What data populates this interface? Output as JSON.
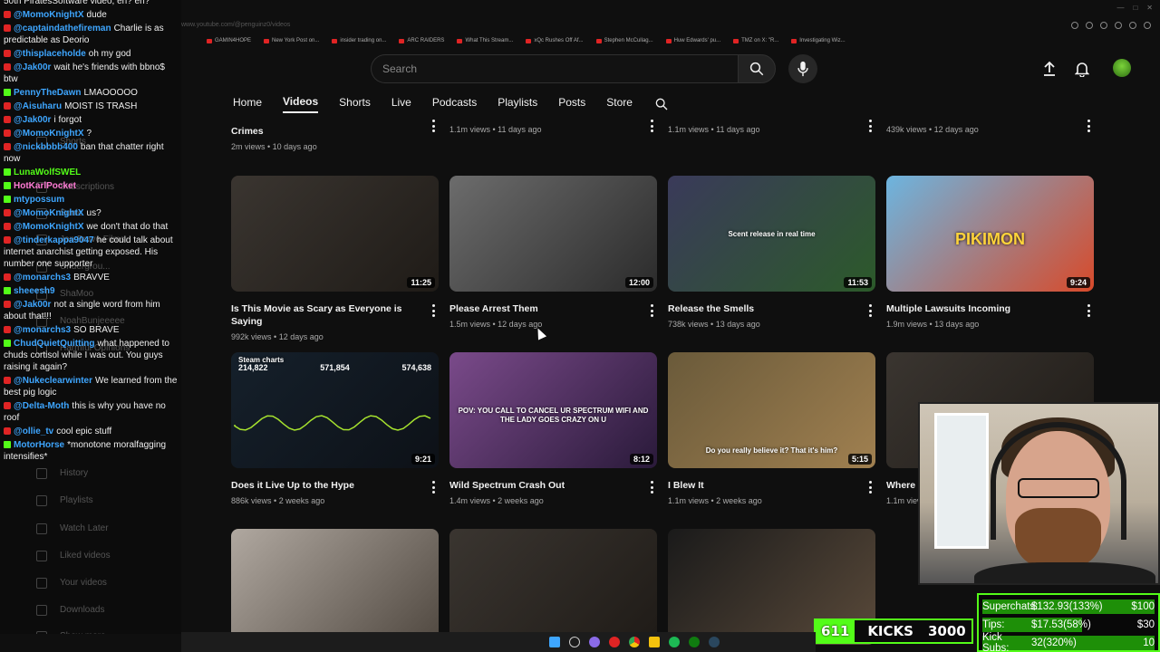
{
  "chat": {
    "header_partial": "50th PiratesSoftware video, eh? eh?",
    "messages": [
      {
        "user": "@MomoKnightX",
        "text": "dude",
        "color": "blue",
        "badge": "yt"
      },
      {
        "user": "@captaindathefireman",
        "text": "Charlie is as predictable as Deorio",
        "color": "blue",
        "badge": "yt"
      },
      {
        "user": "@thisplaceholde",
        "text": "oh my god",
        "color": "blue",
        "badge": "yt"
      },
      {
        "user": "@Jak00r",
        "text": "wait he's friends with bbno$ btw",
        "color": "blue",
        "badge": "yt"
      },
      {
        "user": "PennyTheDawn",
        "text": "LMAOOOOO",
        "color": "blue",
        "badge": "kick"
      },
      {
        "user": "@Aisuharu",
        "text": "MOIST IS TRASH",
        "color": "blue",
        "badge": "yt"
      },
      {
        "user": "@Jak00r",
        "text": "i forgot",
        "color": "blue",
        "badge": "yt"
      },
      {
        "user": "@MomoKnightX",
        "text": "?",
        "color": "blue",
        "badge": "yt"
      },
      {
        "user": "@nickbbbb400",
        "text": "ban that chatter right now",
        "color": "blue",
        "badge": "yt"
      },
      {
        "user": "LunaWolfSWEL",
        "text": "",
        "color": "green",
        "badge": "kick"
      },
      {
        "user": "HotKarlPocket",
        "text": "",
        "color": "pink",
        "badge": "kick"
      },
      {
        "user": "mtypossum",
        "text": "",
        "color": "blue",
        "badge": "kick"
      },
      {
        "user": "@MomoKnightX",
        "text": "us?",
        "color": "blue",
        "badge": "yt"
      },
      {
        "user": "@MomoKnightX",
        "text": "we don't that do that",
        "color": "blue",
        "badge": "yt"
      },
      {
        "user": "@tinderkappa9047",
        "text": "he could talk about internet anarchist getting exposed. His number one supporter",
        "color": "blue",
        "badge": "yt"
      },
      {
        "user": "@monarchs3",
        "text": "BRAVVE",
        "color": "blue",
        "badge": "yt"
      },
      {
        "user": "sheeesh9",
        "text": "",
        "color": "blue",
        "badge": "kick"
      },
      {
        "user": "@Jak00r",
        "text": "not a single word from him about that!!!",
        "color": "blue",
        "badge": "yt"
      },
      {
        "user": "@monarchs3",
        "text": "SO BRAVE",
        "color": "blue",
        "badge": "yt"
      },
      {
        "user": "ChudQuietQuitting",
        "text": "what happened to chuds cortisol while I was out. You guys raising it again?",
        "color": "blue",
        "badge": "kick"
      },
      {
        "user": "@Nukeclearwinter",
        "text": "We learned from the best pig logic",
        "color": "blue",
        "badge": "yt"
      },
      {
        "user": "@Delta-Moth",
        "text": "this is why you have no roof",
        "color": "blue",
        "badge": "yt"
      },
      {
        "user": "@ollie_tv",
        "text": "cool epic stuff",
        "color": "blue",
        "badge": "yt"
      },
      {
        "user": "MotorHorse",
        "text": "*monotone moralfagging intensifies*",
        "color": "blue",
        "badge": "kick"
      }
    ],
    "sidebar_ghost": [
      "Shorts",
      "Subscriptions",
      "Sonic",
      "Jon Bravo Films",
      "Undergrou...",
      "ShaMoo",
      "NoahBunjeeeee",
      "Harmful Opinions",
      "History",
      "Playlists",
      "Watch Later",
      "Liked videos",
      "Your videos",
      "Downloads",
      "Show more"
    ]
  },
  "browser": {
    "url": "www.youtube.com/@penguinz0/videos",
    "bookmarks": [
      "GAMIN4HOPE",
      "New York Post on...",
      "insider trading on...",
      "ARC RAIDERS",
      "What This Stream...",
      "xQc Rushes Off Af...",
      "Stephen McCullag...",
      "Huw Edwards' pu...",
      "TMZ on X: \"R...",
      "Investigating Wiz..."
    ]
  },
  "header": {
    "search_placeholder": "Search"
  },
  "tabs": [
    "Home",
    "Videos",
    "Shorts",
    "Live",
    "Podcasts",
    "Playlists",
    "Posts",
    "Store"
  ],
  "active_tab": "Videos",
  "row_top": [
    {
      "title": "Crimes",
      "meta": "2m views • 10 days ago"
    },
    {
      "title": "",
      "meta": "1.1m views • 11 days ago"
    },
    {
      "title": "",
      "meta": "1.1m views • 11 days ago"
    },
    {
      "title": "",
      "meta": "439k views • 12 days ago"
    }
  ],
  "videos": [
    {
      "title": "Is This Movie as Scary as Everyone is Saying",
      "views": "992k views",
      "age": "12 days ago",
      "duration": "11:25",
      "thumb_colors": [
        "#3a3530",
        "#1f1b17"
      ]
    },
    {
      "title": "Please Arrest Them",
      "views": "1.5m views",
      "age": "12 days ago",
      "duration": "12:00",
      "thumb_colors": [
        "#6c6c6c",
        "#2b2b2b"
      ]
    },
    {
      "title": "Release the Smells",
      "views": "738k views",
      "age": "13 days ago",
      "duration": "11:53",
      "thumb_colors": [
        "#3a3a5a",
        "#2c5a2a"
      ],
      "thumb_text": "Scent release in real time"
    },
    {
      "title": "Multiple Lawsuits Incoming",
      "views": "1.9m views",
      "age": "13 days ago",
      "duration": "9:24",
      "thumb_colors": [
        "#6cb5e0",
        "#d84a2a"
      ],
      "thumb_text": "PIKIMON"
    },
    {
      "title": "Does it Live Up to the Hype",
      "views": "886k views",
      "age": "2 weeks ago",
      "duration": "9:21",
      "thumb_colors": [
        "#15202b",
        "#0d1117"
      ],
      "thumb_text": "Steam charts"
    },
    {
      "title": "Wild Spectrum Crash Out",
      "views": "1.4m views",
      "age": "2 weeks ago",
      "duration": "8:12",
      "thumb_colors": [
        "#7a4a8a",
        "#2a1a3a"
      ],
      "thumb_text": "POV: YOU CALL TO CANCEL UR SPECTRUM WIFI AND THE LADY GOES CRAZY ON U"
    },
    {
      "title": "I Blew It",
      "views": "1.1m views",
      "age": "2 weeks ago",
      "duration": "5:15",
      "thumb_colors": [
        "#6a5a3a",
        "#a08050"
      ],
      "thumb_text": "Do you really believe it? That it's him?"
    },
    {
      "title": "Where i",
      "views": "1.1m views",
      "age": "2 weeks ago",
      "duration": "",
      "thumb_colors": [
        "#3a3530",
        "#1f1b17"
      ]
    },
    {
      "title": "",
      "views": "",
      "age": "",
      "duration": "",
      "thumb_colors": [
        "#b0a8a0",
        "#504840"
      ]
    },
    {
      "title": "",
      "views": "",
      "age": "",
      "duration": "",
      "thumb_colors": [
        "#3a3530",
        "#1f1b17"
      ]
    },
    {
      "title": "",
      "views": "",
      "age": "",
      "duration": "",
      "thumb_colors": [
        "#1a1a1a",
        "#5a4a3a"
      ]
    }
  ],
  "steam_stats": [
    "214,822",
    "571,854",
    "574,638"
  ],
  "kicks": {
    "count": "611",
    "label": "KICKS",
    "goal": "3000"
  },
  "goals": [
    {
      "label": "Superchats:",
      "value": "$132.93(133%)",
      "target": "$100",
      "fill": 1.0
    },
    {
      "label": "Tips:",
      "value": "$17.53(58%)",
      "target": "$30",
      "fill": 0.58
    },
    {
      "label": "Kick Subs:",
      "value": "32(320%)",
      "target": "10",
      "fill": 1.0
    }
  ],
  "colors": {
    "accent_kick": "#53fc18",
    "yt_red": "#e02424",
    "link_blue": "#3ea6ff"
  }
}
